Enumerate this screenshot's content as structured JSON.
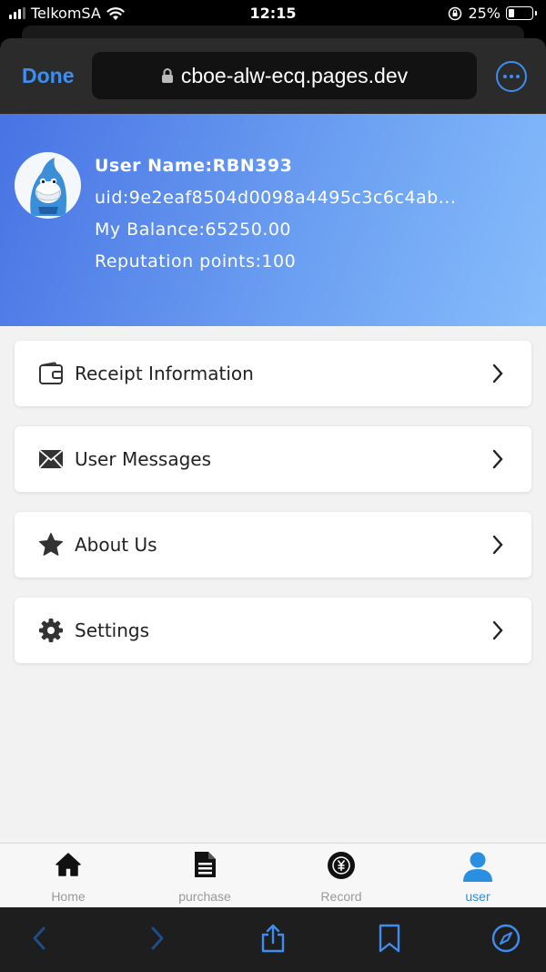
{
  "status": {
    "carrier": "TelkomSA",
    "time": "12:15",
    "battery": "25%",
    "battery_level": 0.25
  },
  "browser": {
    "done_label": "Done",
    "url": "cboe-alw-ecq.pages.dev",
    "icons": [
      "lock-icon",
      "more-icon"
    ]
  },
  "profile": {
    "username": "User Name:RBN393",
    "uid": "uid:9e2eaf8504d0098a4495c3c6c4ab...",
    "balance": "My Balance:65250.00",
    "reputation": "Reputation points:100",
    "banner_colors": [
      "#4873e4",
      "#86bdfb"
    ]
  },
  "menu": [
    {
      "label": "Receipt Information",
      "icon": "wallet-icon"
    },
    {
      "label": "User Messages",
      "icon": "envelope-icon"
    },
    {
      "label": "About Us",
      "icon": "star-icon"
    },
    {
      "label": "Settings",
      "icon": "gear-icon"
    }
  ],
  "tabs": [
    {
      "label": "Home",
      "icon": "home-icon"
    },
    {
      "label": "purchase",
      "icon": "document-icon"
    },
    {
      "label": "Record",
      "icon": "coin-icon"
    },
    {
      "label": "user",
      "icon": "user-icon",
      "active": true
    }
  ],
  "toolbar": {
    "icons": [
      "back-icon",
      "forward-icon",
      "share-icon",
      "bookmarks-icon",
      "compass-icon"
    ]
  },
  "colors": {
    "accent": "#3d8ef0",
    "active_tab": "#2a8fe0",
    "page_background": "#f2f2f2"
  }
}
